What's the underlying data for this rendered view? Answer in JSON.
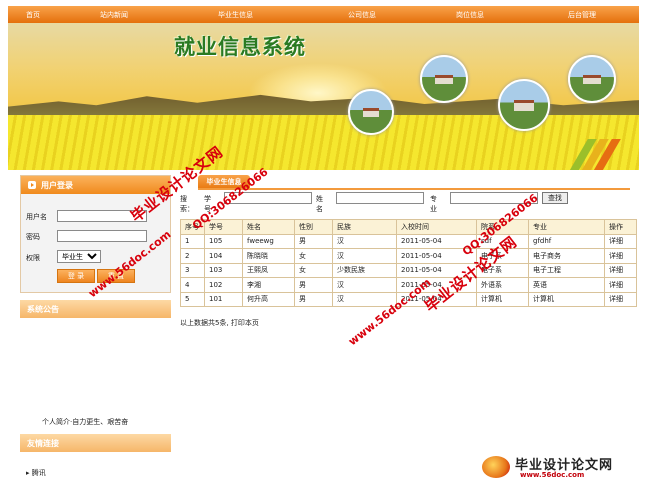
{
  "nav": {
    "items": [
      "首页",
      "站内新闻",
      "毕业生信息",
      "公司信息",
      "岗位信息",
      "后台管理"
    ]
  },
  "banner": {
    "title": "就业信息系统"
  },
  "login": {
    "title": "用户登录",
    "username_label": "用户名",
    "password_label": "密码",
    "role_label": "权限",
    "role_selected": "毕业生",
    "login_button": "登 录",
    "reset_button": "重 置"
  },
  "notice": {
    "title": "系统公告",
    "scroll_text": "个人简介·自力更生、艰苦奋"
  },
  "links": {
    "title": "友情连接",
    "items": [
      "腾讯"
    ]
  },
  "main": {
    "tab_label": "毕业生信息",
    "search": {
      "prefix": "搜索：",
      "student_id_label": "学号",
      "name_label": "姓名",
      "major_label": "专业",
      "button": "查找"
    },
    "columns": [
      "序号",
      "学号",
      "姓名",
      "性别",
      "民族",
      "入校时间",
      "院系",
      "专业",
      "操作"
    ],
    "rows": [
      [
        "1",
        "105",
        "fweewg",
        "男",
        "汉",
        "2011-05-04",
        "sdf",
        "gfdhf",
        "详细"
      ],
      [
        "2",
        "104",
        "陈晓晓",
        "女",
        "汉",
        "2011-05-04",
        "电子系",
        "电子商务",
        "详细"
      ],
      [
        "3",
        "103",
        "王熙凤",
        "女",
        "少数民族",
        "2011-05-04",
        "电子系",
        "电子工程",
        "详细"
      ],
      [
        "4",
        "102",
        "李湘",
        "男",
        "汉",
        "2011-05-04",
        "外语系",
        "英语",
        "详细"
      ],
      [
        "5",
        "101",
        "何升高",
        "男",
        "汉",
        "2011-05-04",
        "计算机",
        "计算机",
        "详细"
      ]
    ],
    "footer": "以上数据共5条, 打印本页"
  },
  "watermarks": {
    "site_name": "毕业设计论文网",
    "url": "www.56doc.com",
    "qq": "QQ:306826066"
  },
  "brand": {
    "name": "毕业设计论文网",
    "url": "www.56doc.com"
  }
}
